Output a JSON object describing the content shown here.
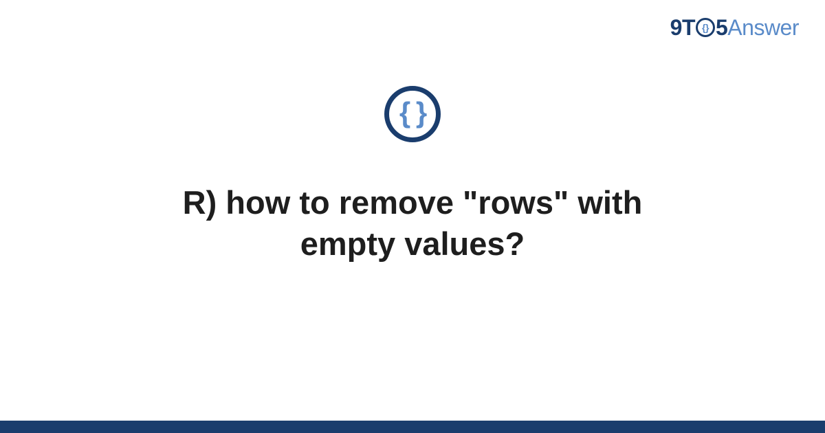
{
  "logo": {
    "part1": "9T",
    "braces": "{}",
    "part2": "5",
    "part3": "Answer"
  },
  "icon": {
    "name": "code-braces-icon",
    "glyph": "{ }"
  },
  "title": "R) how to remove \"rows\" with empty values?",
  "colors": {
    "dark_navy": "#1a3d6d",
    "light_blue": "#5a8bc9",
    "text": "#1e1e1e"
  }
}
